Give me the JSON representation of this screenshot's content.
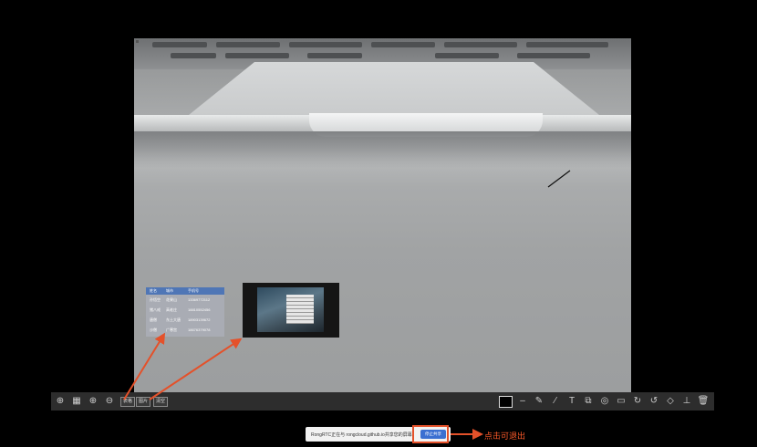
{
  "table_overlay": {
    "headers": [
      "姓名",
      "城市",
      "手机号"
    ],
    "rows": [
      [
        "孙悟空",
        "花果山",
        "13369772112"
      ],
      [
        "猪八戒",
        "高老庄",
        "18810552456"
      ],
      [
        "唐僧",
        "东土大唐",
        "18903139672"
      ],
      [
        "沙僧",
        "广寒宫",
        "18676379078"
      ]
    ]
  },
  "toolbar": {
    "left_icons": [
      "plus-circle-icon",
      "grid-icon",
      "zoom-in-icon",
      "zoom-out-icon"
    ],
    "left_buttons": [
      "表格",
      "图片",
      "清空"
    ],
    "right_icons": [
      "minus-icon",
      "pen-icon",
      "brush-icon",
      "text-icon",
      "shapes-icon",
      "circle-icon",
      "rectangle-icon",
      "redo-arc-icon",
      "undo-arc-icon",
      "eraser-icon",
      "clear-icon",
      "trash-icon"
    ],
    "pen_color": "#000000"
  },
  "share_bar": {
    "text": "RongRTC正在与 rongcloud.github.io共享您的屏幕。",
    "stop_label": "停止共享"
  },
  "annotation": {
    "exit_hint": "点击可退出",
    "arrow_color": "#e4512a"
  }
}
